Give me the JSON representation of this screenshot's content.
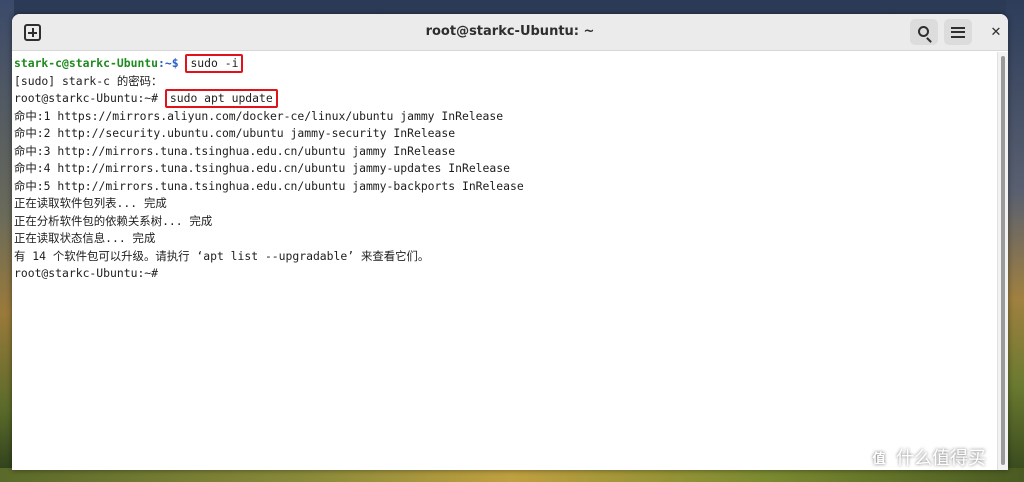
{
  "window": {
    "title": "root@starkc-Ubuntu: ~",
    "new_tab_icon": "new-tab-icon",
    "search_icon": "search-icon",
    "menu_icon": "hamburger-menu-icon",
    "close_label": "✕"
  },
  "terminal": {
    "line0": {
      "user": "stark-c@starkc-Ubuntu",
      "sep": ":~$ ",
      "cmd": "sudo -i"
    },
    "line1": "[sudo] stark-c 的密码：",
    "line2": {
      "prompt": "root@starkc-Ubuntu:~# ",
      "cmd": "sudo apt update"
    },
    "output": [
      "命中:1 https://mirrors.aliyun.com/docker-ce/linux/ubuntu jammy InRelease",
      "命中:2 http://security.ubuntu.com/ubuntu jammy-security InRelease",
      "命中:3 http://mirrors.tuna.tsinghua.edu.cn/ubuntu jammy InRelease",
      "命中:4 http://mirrors.tuna.tsinghua.edu.cn/ubuntu jammy-updates InRelease",
      "命中:5 http://mirrors.tuna.tsinghua.edu.cn/ubuntu jammy-backports InRelease",
      "正在读取软件包列表... 完成",
      "正在分析软件包的依赖关系树... 完成",
      "正在读取状态信息... 完成",
      "有 14 个软件包可以升级。请执行 ‘apt list --upgradable’ 来查看它们。"
    ],
    "last_prompt": "root@starkc-Ubuntu:~# "
  },
  "watermark": {
    "mark": "值",
    "text": "什么值得买"
  },
  "colors": {
    "highlight_box": "#e0121c",
    "prompt_green": "#1f8a1f",
    "path_blue": "#2a60c8"
  }
}
